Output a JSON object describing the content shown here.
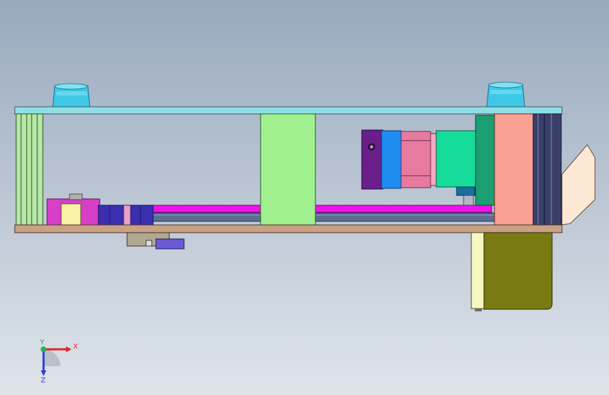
{
  "viewport": {
    "background_top": "#98a9be",
    "background_bottom": "#dfe4ea"
  },
  "triad": {
    "x_label": "X",
    "y_label": "Y",
    "z_label": "Z",
    "x_color": "#e0242a",
    "y_color": "#22b14c",
    "z_color": "#2a3fd6"
  },
  "colors": {
    "top_plate": "#8fe0e6",
    "bottom_plate": "#c9a285",
    "cyan_feet": "#3ec8e6",
    "green_post": "#a0f08f",
    "left_frame": "#b6e8a6",
    "magenta_rail": "#f012e8",
    "shaft": "#5a6f92",
    "salmon_block": "#f8a094",
    "dark_frame": "#3a3f6a",
    "motor_olive": "#7a7a12",
    "motor_face": "#f7f7c2",
    "coupling_purple": "#6a1e8a",
    "coupling_blue": "#1e8cf0",
    "coupling_pink": "#e87aa0",
    "gearbox_green": "#15dc9a",
    "gearbox_teal": "#1a9e72",
    "bracket_peach": "#fde8d6"
  }
}
